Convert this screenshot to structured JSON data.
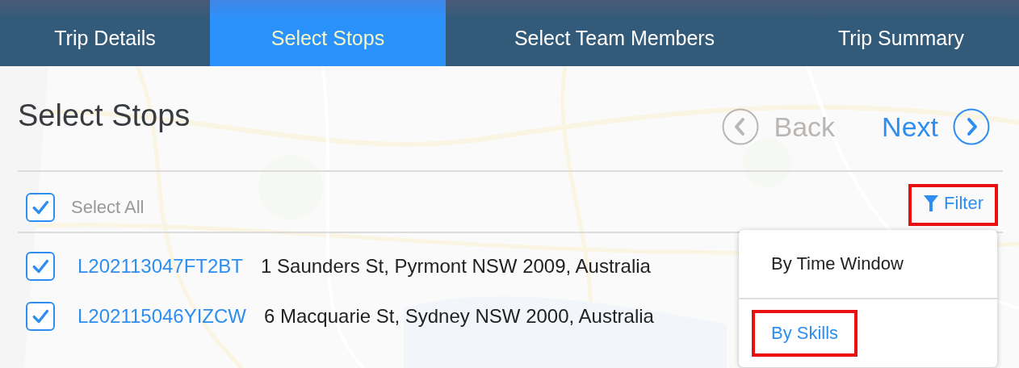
{
  "tabs": [
    {
      "label": "Trip Details",
      "selected": false
    },
    {
      "label": "Select Stops",
      "selected": true
    },
    {
      "label": "Select Team Members",
      "selected": false
    },
    {
      "label": "Trip Summary",
      "selected": false
    }
  ],
  "page_title": "Select Stops",
  "back_button": {
    "label": "Back",
    "disabled": true
  },
  "next_button": {
    "label": "Next",
    "disabled": false
  },
  "select_all": {
    "label": "Select All",
    "checked": true
  },
  "filter": {
    "label": "Filter",
    "highlighted": true
  },
  "filter_menu": [
    {
      "label": "By Time Window",
      "selected": false,
      "highlighted": false
    },
    {
      "label": "By Skills",
      "selected": true,
      "highlighted": true
    }
  ],
  "stops": [
    {
      "id": "L202113047FT2BT",
      "address": "1 Saunders St, Pyrmont NSW 2009, Australia",
      "checked": true
    },
    {
      "id": "L202115046YIZCW",
      "address": "6 Macquarie St, Sydney NSW 2000, Australia",
      "checked": true
    }
  ]
}
